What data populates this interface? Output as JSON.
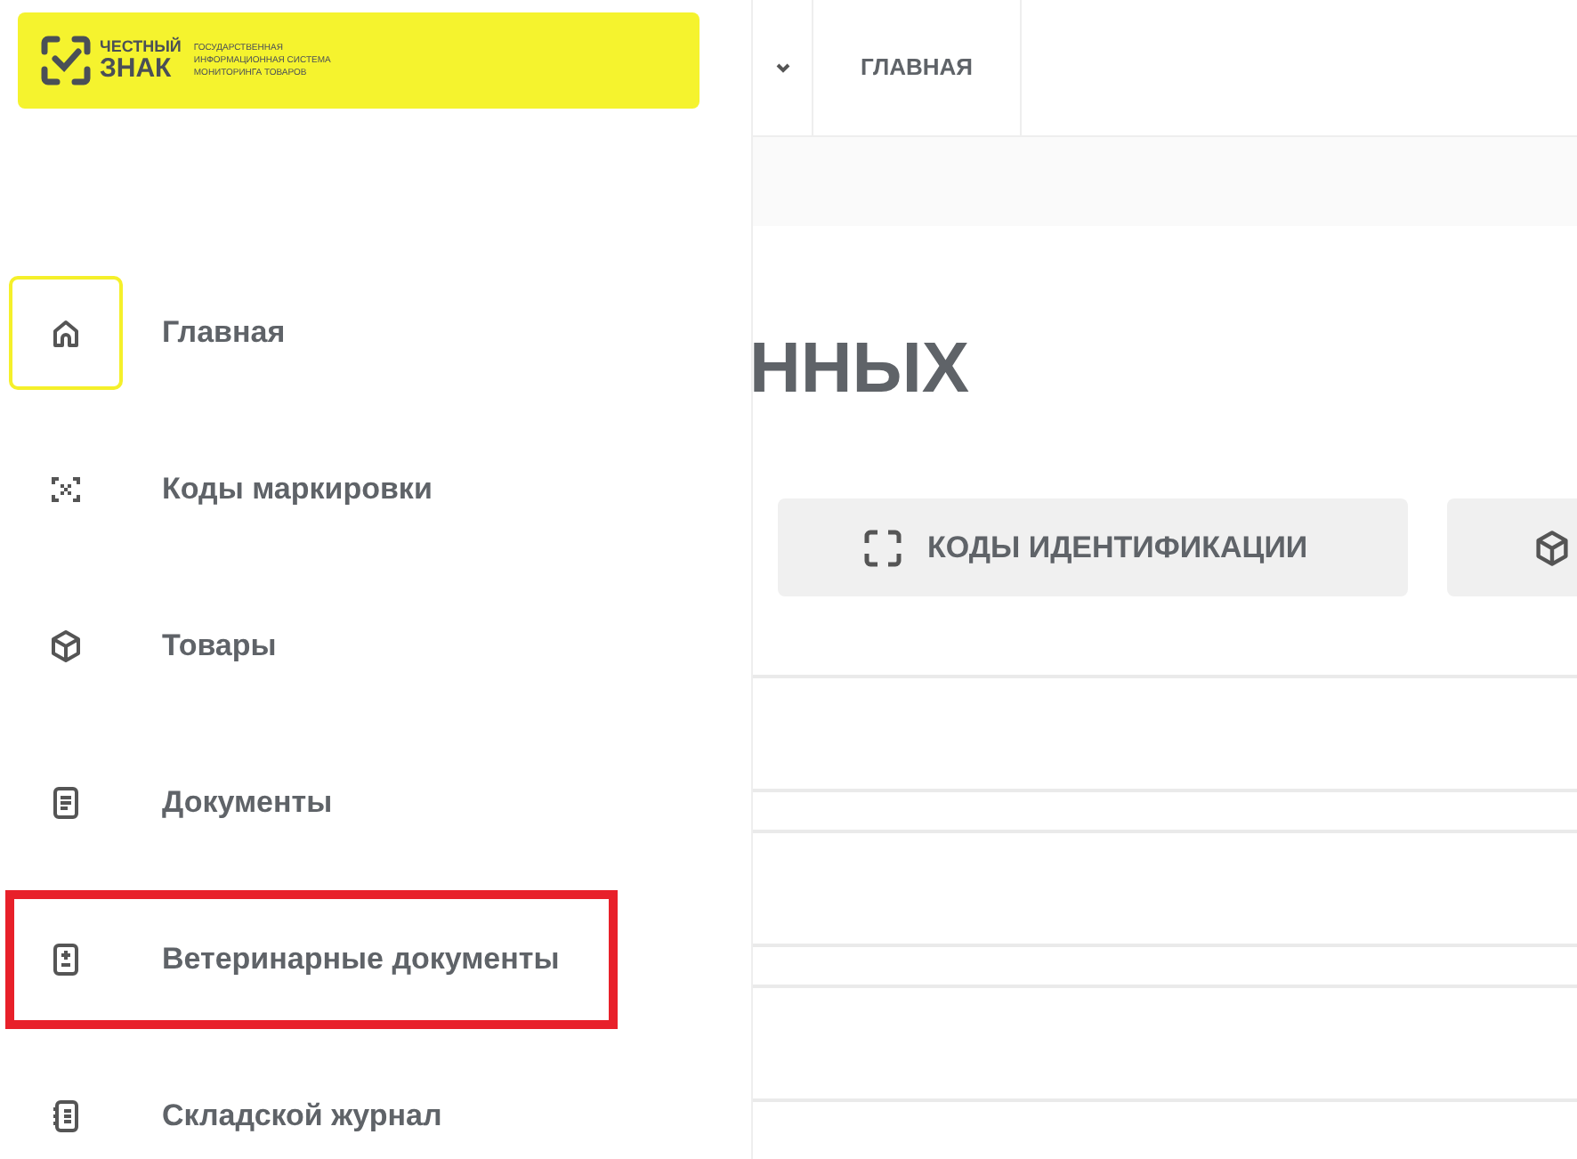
{
  "logo": {
    "brand_line_1": "ЧЕСТНЫЙ",
    "brand_line_2": "ЗНАК",
    "tagline": [
      "ГОСУДАРСТВЕННАЯ",
      "ИНФОРМАЦИОННАЯ СИСТЕМА",
      "МОНИТОРИНГА ТОВАРОВ"
    ]
  },
  "sidebar": {
    "items": [
      {
        "kind": "home",
        "label": "Главная",
        "selected": true,
        "highlighted": false
      },
      {
        "kind": "codes",
        "label": "Коды маркировки",
        "selected": false,
        "highlighted": false
      },
      {
        "kind": "goods",
        "label": "Товары",
        "selected": false,
        "highlighted": false
      },
      {
        "kind": "documents",
        "label": "Документы",
        "selected": false,
        "highlighted": false
      },
      {
        "kind": "vet",
        "label": "Ветеринарные документы",
        "selected": false,
        "highlighted": true
      },
      {
        "kind": "journal",
        "label": "Складской журнал",
        "selected": false,
        "highlighted": false
      }
    ]
  },
  "top_bar": {
    "tabs": [
      {
        "label": "ГЛАВНАЯ"
      }
    ]
  },
  "main": {
    "heading": "ННЫХ",
    "buttons": [
      {
        "kind": "codes",
        "label": "КОДЫ ИДЕНТИФИКАЦИИ"
      },
      {
        "kind": "goods"
      }
    ]
  }
}
